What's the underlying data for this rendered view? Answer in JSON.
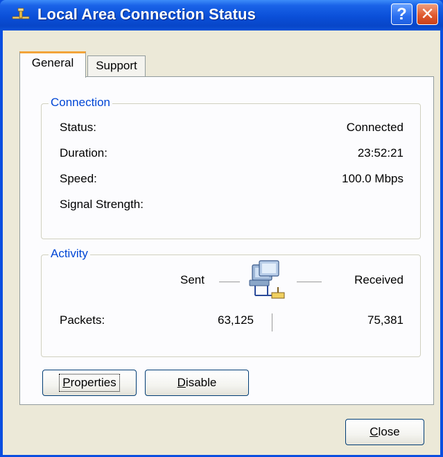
{
  "window": {
    "title": "Local Area Connection Status",
    "help_glyph": "?",
    "close_glyph": "✕"
  },
  "tabs": [
    {
      "label": "General",
      "selected": true
    },
    {
      "label": "Support",
      "selected": false
    }
  ],
  "connection": {
    "legend": "Connection",
    "rows": [
      {
        "label": "Status:",
        "value": "Connected"
      },
      {
        "label": "Duration:",
        "value": "23:52:21"
      },
      {
        "label": "Speed:",
        "value": "100.0 Mbps"
      },
      {
        "label": "Signal Strength:",
        "value": ""
      }
    ]
  },
  "activity": {
    "legend": "Activity",
    "sent_label": "Sent",
    "received_label": "Received",
    "packets_label": "Packets:",
    "packets_sent": "63,125",
    "packets_received": "75,381",
    "icon": "network-computers-icon"
  },
  "buttons": {
    "properties": {
      "mnemonic": "P",
      "rest": "roperties"
    },
    "disable": {
      "mnemonic": "D",
      "rest": "isable"
    },
    "close": {
      "mnemonic": "C",
      "rest": "lose"
    }
  },
  "colors": {
    "titlebar": "#0a4fd8",
    "client_bg": "#ece9d8",
    "group_legend": "#0046d5",
    "selected_tab_accent": "#f2a43a"
  }
}
